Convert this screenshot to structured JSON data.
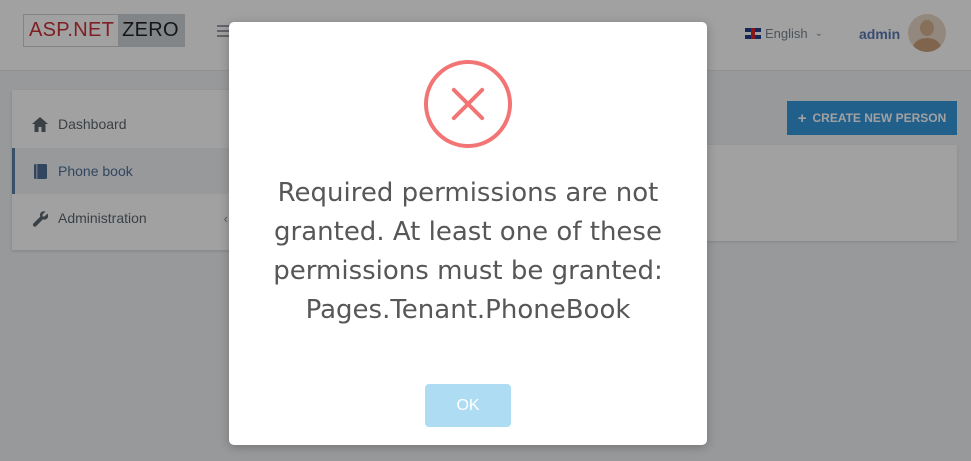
{
  "header": {
    "logo_left": "ASP.NET",
    "logo_right": "ZERO",
    "language": "English",
    "user_name": "admin"
  },
  "sidebar": {
    "items": [
      {
        "label": "Dashboard",
        "icon": "home-icon"
      },
      {
        "label": "Phone book",
        "icon": "book-icon",
        "active": true
      },
      {
        "label": "Administration",
        "icon": "wrench-icon",
        "has_submenu": true
      }
    ]
  },
  "main": {
    "create_button_label": "CREATE NEW PERSON"
  },
  "modal": {
    "icon": "error-x-icon",
    "message": "Required permissions are not granted. At least one of these permissions must be granted: Pages.Tenant.PhoneBook",
    "ok_label": "OK"
  },
  "colors": {
    "accent": "#3598dc",
    "error": "#f27474",
    "ok_button": "#addcf3"
  }
}
